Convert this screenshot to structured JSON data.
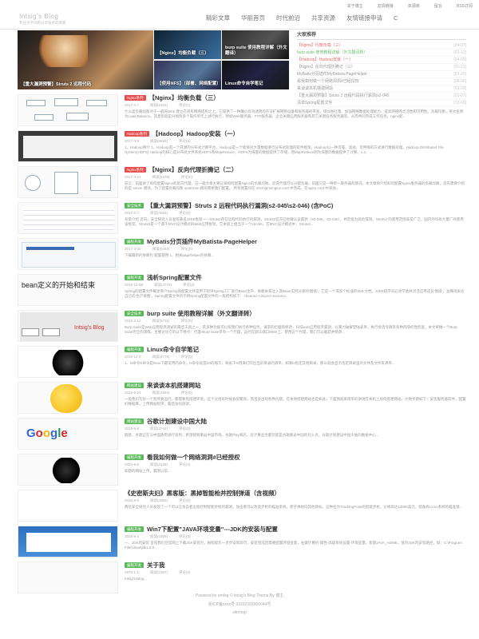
{
  "topbar": {
    "links": [
      "关于博主",
      "友情链接",
      "资源库",
      "留言",
      "RSS订阅"
    ]
  },
  "brand": {
    "title": "Intsig's Blog",
    "tagline": "专注于学习和分享技术的博客"
  },
  "nav": [
    "精彩文章",
    "华丽首页",
    "时代前沿",
    "共享资源",
    "友情链接申请",
    "C"
  ],
  "slider": {
    "big": "【重大漏洞预警】Struts 2 远程代码",
    "s1": "【Nginx】均衡负载（三）",
    "s2": "burp suite 使用教程详解（外文翻译）",
    "s3": "【使用NFS】（部署、网络配置）",
    "s4": "Linux命令自学笔记"
  },
  "sidebar": {
    "title": "大家推荐",
    "items": [
      {
        "t": "【Nginx】均衡负载（三）",
        "d": "[04-07]",
        "c": "red"
      },
      {
        "t": "burp suite 使用教程详解（外文翻译转）",
        "d": "[03-12]",
        "c": "grn"
      },
      {
        "t": "【Hadoop】Hadoop安装（一）",
        "d": "[04-05]",
        "c": "red"
      },
      {
        "t": "【Nginx】反向代理折腾记（三）",
        "d": "[03-21]",
        "c": ""
      },
      {
        "t": "MyBatis分页插件MyBatista-PageHelper",
        "d": "[02-20]",
        "c": ""
      },
      {
        "t": "看我如何做一个网络洞洞#已经授权",
        "d": "[06-06]",
        "c": ""
      },
      {
        "t": "来谈谈本机搭建网站",
        "d": "[03-09]",
        "c": ""
      },
      {
        "t": "【重大漏洞预警】Struts 2 远程代码执行漏洞(s2-045",
        "d": "[03-07]",
        "c": ""
      },
      {
        "t": "清单Spring配置文件",
        "d": "[12-08]",
        "c": ""
      }
    ]
  },
  "posts": [
    {
      "cat": "Nginx系列",
      "cc": "red",
      "title": "【Nginx】均衡负载（三）",
      "date": "2017-4-7",
      "views": "阅读(2316)",
      "comments": "评论(1)",
      "excerpt": "什么是负载均衡对于一般的Web 建立在现有网络结构之上，它提供了一种廉价有效透明的方法扩展网络设备和服务器的带宽、增加吞吐量、加强网络数据处理能力、提高网络的灵活性和可用性。负载均衡，英文名称为Load Balance，其意思就是分摊到多个操作单元上进行执行，例如Web服务器、FTP服务器、企业关键应用服务器和其它关键任务服务器等，从而共同完成工作任务。nginx配..."
    },
    {
      "cat": "Hadoop系列",
      "cc": "red",
      "title": "【Hadoop】Hadoop安装（一）",
      "date": "2017-4-5",
      "views": "阅读(5669)",
      "comments": "评论(0)",
      "excerpt": "1、Hadoop简介 1、Hadoop是一个开源的分布式计算平台，Hadoop是一个能够对大量数据进行分布式处理的软件框架。Hadoop以一种可靠、高效、可伸缩的方式进行数据处理。Hadoop Distributed File System(HDFS) Hadoop的核心是分布式文件系统HDFS和MapReduce，HDFS为海量的数据提供了存储，而MapReduce则为海量的数据提供了计算。1.2、..."
    },
    {
      "cat": "Nginx系列",
      "cc": "red",
      "title": "【Nginx】反向代理折腾记（二）",
      "date": "2017-3-21",
      "views": "阅读(5479)",
      "comments": "评论(0)",
      "excerpt": "前言：前面讲了如何配置Nginx的反向代理，这一篇文章主要记录如何配置Nginx的负载均衡。反向代理可以分配负载，前面只是一种单一服务器的情况。本文章将介绍如何配置Nginx服务器的负载均衡，首先需要介绍的是 server 模块。为了配置负载均衡 upstream 模块需要我们配置。 所有配置均在 /etc/nginx/nginx.conf 中完成。在nginx.conf 中添加..."
    },
    {
      "cat": "安全技术",
      "cc": "grn",
      "title": "【重大漏洞预警】Struts 2 远程代码执行漏洞(s2-045\\s2-046) (含PoC)",
      "date": "2017-3-7",
      "views": "阅读(4654)",
      "comments": "评论(0)",
      "excerpt": "背景介绍 近日，安全研究人员发现著名J2EE框架——Struts2存在远程代码执行的漏洞，Struts2官方已经确认该漏洞（S2-045，S2-046），并定级为高危漏洞。Struts2 的使用范围非常广泛，国内外均有大量厂商使用该框架。Struts2是一个基于MVC设计模式的Web应用框架，它本质上相当于一个servlet，在MVC设计模式中，Struts2..."
    },
    {
      "cat": "编程开发",
      "cc": "grn",
      "title": "MyBatis分页插件MyBatista-PageHelper",
      "date": "2017-2-20",
      "views": "阅读(6442)",
      "comments": "评论(0)",
      "excerpt": "下载最新的依赖包 配置使用 1、相关pagehelper的依赖..."
    },
    {
      "cat": "编程开发",
      "cc": "grn",
      "title": "浅析Spring配置文件",
      "date": "2016-12-08",
      "views": "阅读(4779)",
      "comments": "评论(0)",
      "excerpt": "Spring的配置文件概述简介Spring的配置文件是用于指导Spring工厂进行Bean生产、依赖关系注入及Bean实例分发的'图纸'，它是一个或多个标准的XML文档，J2EE程序员必须学会并灵活应用这份'图纸'，准确地表达自己的'生产意图'。Spring配置文件的示例Spring配置文件的一般结构如下：<beans> <import resource..."
    },
    {
      "cat": "安全技术",
      "cc": "grn",
      "title": "burp suite 使用教程详解（外文翻译转）",
      "date": "2016-3-12",
      "views": "阅读(5731)",
      "comments": "评论(0)",
      "excerpt": "Burp Suite是Web应用程序测试的最佳工具之一，其多种功能可以帮我们执行各种任务。请求的拦截和修改，扫描web应用程序漏洞，以暴力破解登陆表单，执行会话令牌等多种的随机性检查。本文将做一个Burp Suite完全的演练，主要讨论它的以下特点：代理-Burp Suite带有一个代理，运行在默认端口8080上，使用这个代理，我们可以截获并修改..."
    },
    {
      "cat": "编程开发",
      "cc": "grn",
      "title": "Linux命令自学笔记",
      "date": "2015-12-3",
      "views": "阅读(4779)",
      "comments": "评论(0)",
      "excerpt": "1、ls命令ls命令是linux下最常用的命令。ls命令就是list的缩写，缺省下ls用来打印出当前目录的清单，如果ls指定其他目录，那么就会显示指定目录里的文件及文件夹清单..."
    },
    {
      "cat": "网站建设",
      "cc": "grn",
      "title": "来谈谈本机搭建网站",
      "date": "2015-9-24",
      "views": "阅读(4664)",
      "comments": "评论(0)",
      "excerpt": "一般我们写好一个程序要运行，都需要先搭建环境，这个过程有时候会很繁琐，而且会出现各种问题。在本地搭建网站也是如此，下面我就来简单的讲讲在本机上如何搭建网站，大致步骤如下：安装服务器软件，配置好数据库，上传网站程序，最后访问测试..."
    },
    {
      "cat": "网站建设",
      "cc": "grn",
      "title": "谷歌计划建设中国大陆",
      "date": "2015-9-8",
      "views": "阅读(3744)",
      "comments": "评论(0)",
      "excerpt": "据悉，谷歌正在与中国政府进行谈判，希望能够重返中国市场。谷歌Play商店、云计算业务都可能是谷歌重返中国的切入点，谷歌计划建设中国大陆的数据中心..."
    },
    {
      "cat": "编程开发",
      "cc": "grn",
      "title": "看我如何做一个网络洞洞#已经授权",
      "date": "2015-6-6",
      "views": "阅读(3138)",
      "comments": "评论(0)",
      "excerpt": "如题的网站上传，漏洞以前..."
    },
    {
      "cat": "",
      "cc": "",
      "title": "《史密斯夫妇》黑客版：黑掉智能枪并控制弹道（含视频）",
      "date": "2015-8-9",
      "views": "阅读(3093)",
      "comments": "评论(0)",
      "excerpt": "两位安全研究人员发现了一个可以让攻击者远程控制智能步枪的漏洞，攻击者可以改变步枪的瞄准系统，使子弹射向其他目标。这种名为TrackingPoint的智能步枪，价格高达13000美元，配备有Linux系统的瞄准镜..."
    },
    {
      "cat": "编程开发",
      "cc": "grn",
      "title": "Win7下配置\"JAVA环境变量\"---JDK的安装与配置",
      "date": "2015-9-4",
      "views": "阅读(4269)",
      "comments": "评论(0)",
      "excerpt": "一、JDK的安装 首先我们在官网上下载JDK安装包，按照提示一步步安装即可，安装完成后需要配置环境变量，右键计算机-属性-高级系统设置-环境变量，新建JAVA_HOME，值为JDK的安装路径，如：C:\\Program Files\\Java\\jdk1.8.0..."
    },
    {
      "cat": "编程开发",
      "cc": "grn",
      "title": "关于我",
      "date": "1970-1-1",
      "views": "阅读(1587)",
      "comments": "评论(0)",
      "excerpt": "Intsig's Blog..."
    }
  ],
  "footer": {
    "line1": "Powered by emlog © Intsig's Blog Theme By 博主",
    "line2": "浙ICP备xxxx号 33102302000044号",
    "line3": "sitemap"
  }
}
